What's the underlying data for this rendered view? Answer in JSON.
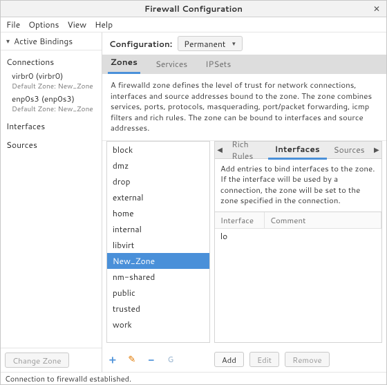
{
  "window": {
    "title": "Firewall Configuration"
  },
  "menubar": [
    "File",
    "Options",
    "View",
    "Help"
  ],
  "sidebar": {
    "header": "Active Bindings",
    "connections_label": "Connections",
    "connections": [
      {
        "name": "virbr0 (virbr0)",
        "sub": "Default Zone: New_Zone"
      },
      {
        "name": "enp0s3 (enp0s3)",
        "sub": "Default Zone: New_Zone"
      }
    ],
    "interfaces_label": "Interfaces",
    "sources_label": "Sources",
    "change_zone": "Change Zone"
  },
  "config": {
    "label": "Configuration:",
    "value": "Permanent"
  },
  "tabs": {
    "zones": "Zones",
    "services": "Services",
    "ipsets": "IPSets"
  },
  "zone_desc": "A firewalld zone defines the level of trust for network connections, interfaces and source addresses bound to the zone. The zone combines services, ports, protocols, masquerading, port/packet forwarding, icmp filters and rich rules. The zone can be bound to interfaces and source addresses.",
  "zones": [
    "block",
    "dmz",
    "drop",
    "external",
    "home",
    "internal",
    "libvirt",
    "New_Zone",
    "nm-shared",
    "public",
    "trusted",
    "work"
  ],
  "zone_selected": "New_Zone",
  "subtabs": {
    "rich": "Rich Rules",
    "interfaces": "Interfaces",
    "sources": "Sources"
  },
  "iface_desc": "Add entries to bind interfaces to the zone. If the interface will be used by a connection, the zone will be set to the zone specified in the connection.",
  "iface_cols": {
    "iface": "Interface",
    "comment": "Comment"
  },
  "iface_rows": [
    {
      "iface": "lo",
      "comment": ""
    }
  ],
  "footer_btns": {
    "add": "Add",
    "edit": "Edit",
    "remove": "Remove"
  },
  "status": "Connection to firewalld established."
}
